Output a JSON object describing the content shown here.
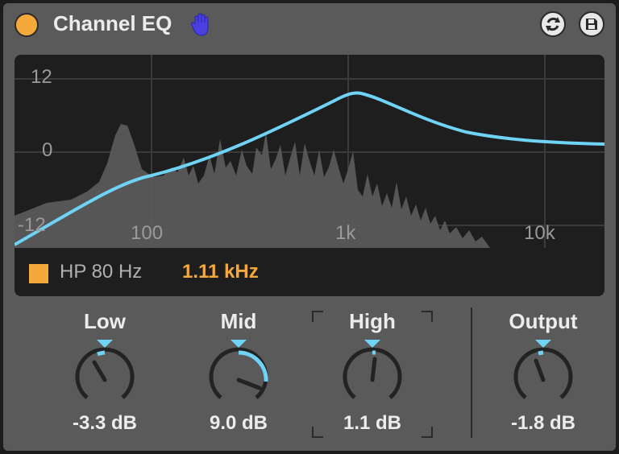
{
  "device": {
    "title": "Channel EQ",
    "power_color": "#f5a93a"
  },
  "toolbar": {
    "hand_icon": "hand-icon",
    "refresh_icon": "refresh-icon",
    "save_icon": "save-icon"
  },
  "display": {
    "y_ticks": [
      "12",
      "0",
      "-12"
    ],
    "x_ticks": [
      "100",
      "1k",
      "10k"
    ],
    "hp_label": "HP 80 Hz",
    "hp_enabled": true,
    "frequency_readout": "1.11 kHz",
    "curve_color": "#6fd3f5",
    "accent_color": "#f5a93a"
  },
  "knobs": [
    {
      "label": "Low",
      "value": "-3.3 dB"
    },
    {
      "label": "Mid",
      "value": "9.0 dB"
    },
    {
      "label": "High",
      "value": "1.1 dB",
      "selected": true
    },
    {
      "label": "Output",
      "value": "-1.8 dB"
    }
  ]
}
